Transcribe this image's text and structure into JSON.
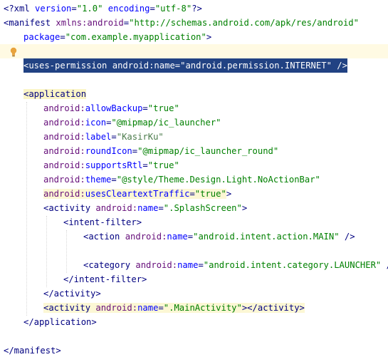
{
  "editor": {
    "file_type": "xml",
    "lines": [
      {
        "indent": 0,
        "segments": [
          {
            "t": "tag",
            "s": "<?xml "
          },
          {
            "t": "attr",
            "s": "version"
          },
          {
            "t": "tag",
            "s": "="
          },
          {
            "t": "val",
            "s": "\"1.0\""
          },
          {
            "t": "tag",
            "s": " "
          },
          {
            "t": "attr",
            "s": "encoding"
          },
          {
            "t": "tag",
            "s": "="
          },
          {
            "t": "val",
            "s": "\"utf-8\""
          },
          {
            "t": "tag",
            "s": "?>"
          }
        ]
      },
      {
        "indent": 0,
        "segments": [
          {
            "t": "tag",
            "s": "<manifest "
          },
          {
            "t": "attr-ns",
            "s": "xmlns:android"
          },
          {
            "t": "tag",
            "s": "="
          },
          {
            "t": "val",
            "s": "\"http://schemas.android.com/apk/res/android\""
          }
        ]
      },
      {
        "indent": 4,
        "segments": [
          {
            "t": "attr",
            "s": "package"
          },
          {
            "t": "tag",
            "s": "="
          },
          {
            "t": "val",
            "s": "\"com.example.myapplication\""
          },
          {
            "t": "tag",
            "s": ">"
          }
        ]
      },
      {
        "indent": 0,
        "segments": [],
        "caret": true,
        "bulb": true
      },
      {
        "indent": 4,
        "selected": true,
        "segments": [
          {
            "t": "sel",
            "s": "<uses-permission android:name=\"android.permission.INTERNET\" />"
          }
        ]
      },
      {
        "indent": 0,
        "segments": []
      },
      {
        "indent": 4,
        "segments": [
          {
            "t": "tag",
            "s": "<",
            "hl": "yellow2"
          },
          {
            "t": "tag",
            "s": "application",
            "hl": "yellow2"
          }
        ]
      },
      {
        "indent": 8,
        "segments": [
          {
            "t": "attr-ns",
            "s": "android:"
          },
          {
            "t": "attr",
            "s": "allowBackup"
          },
          {
            "t": "tag",
            "s": "="
          },
          {
            "t": "val",
            "s": "\"true\""
          }
        ]
      },
      {
        "indent": 8,
        "segments": [
          {
            "t": "attr-ns",
            "s": "android:"
          },
          {
            "t": "attr",
            "s": "icon"
          },
          {
            "t": "tag",
            "s": "="
          },
          {
            "t": "val",
            "s": "\"@mipmap/ic_launcher\""
          }
        ]
      },
      {
        "indent": 8,
        "segments": [
          {
            "t": "attr-ns",
            "s": "android:"
          },
          {
            "t": "attr",
            "s": "label"
          },
          {
            "t": "tag",
            "s": "="
          },
          {
            "t": "val-dim",
            "s": "\"KasirKu\""
          }
        ]
      },
      {
        "indent": 8,
        "segments": [
          {
            "t": "attr-ns",
            "s": "android:"
          },
          {
            "t": "attr",
            "s": "roundIcon"
          },
          {
            "t": "tag",
            "s": "="
          },
          {
            "t": "val",
            "s": "\"@mipmap/ic_launcher_round\""
          }
        ]
      },
      {
        "indent": 8,
        "segments": [
          {
            "t": "attr-ns",
            "s": "android:"
          },
          {
            "t": "attr",
            "s": "supportsRtl"
          },
          {
            "t": "tag",
            "s": "="
          },
          {
            "t": "val",
            "s": "\"true\""
          }
        ]
      },
      {
        "indent": 8,
        "segments": [
          {
            "t": "attr-ns",
            "s": "android:"
          },
          {
            "t": "attr",
            "s": "theme"
          },
          {
            "t": "tag",
            "s": "="
          },
          {
            "t": "val",
            "s": "\"@style/Theme.Design.Light.NoActionBar\""
          }
        ]
      },
      {
        "indent": 8,
        "segments": [
          {
            "t": "attr-ns",
            "s": "android:",
            "hl": "yellow"
          },
          {
            "t": "attr",
            "s": "usesCleartextTraffic",
            "hl": "yellow"
          },
          {
            "t": "tag",
            "s": "=",
            "hl": "yellow"
          },
          {
            "t": "val",
            "s": "\"true\"",
            "hl": "yellow"
          },
          {
            "t": "tag",
            "s": ">"
          }
        ]
      },
      {
        "indent": 8,
        "segments": [
          {
            "t": "tag",
            "s": "<activity "
          },
          {
            "t": "attr-ns",
            "s": "android:"
          },
          {
            "t": "attr",
            "s": "name"
          },
          {
            "t": "tag",
            "s": "="
          },
          {
            "t": "val",
            "s": "\".SplashScreen\""
          },
          {
            "t": "tag",
            "s": ">"
          }
        ]
      },
      {
        "indent": 12,
        "segments": [
          {
            "t": "tag",
            "s": "<intent-filter>"
          }
        ]
      },
      {
        "indent": 16,
        "segments": [
          {
            "t": "tag",
            "s": "<action "
          },
          {
            "t": "attr-ns",
            "s": "android:"
          },
          {
            "t": "attr",
            "s": "name"
          },
          {
            "t": "tag",
            "s": "="
          },
          {
            "t": "val",
            "s": "\"android.intent.action.MAIN\""
          },
          {
            "t": "tag",
            "s": " />"
          }
        ]
      },
      {
        "indent": 0,
        "segments": []
      },
      {
        "indent": 16,
        "segments": [
          {
            "t": "tag",
            "s": "<category "
          },
          {
            "t": "attr-ns",
            "s": "android:"
          },
          {
            "t": "attr",
            "s": "name"
          },
          {
            "t": "tag",
            "s": "="
          },
          {
            "t": "val",
            "s": "\"android.intent.category.LAUNCHER\""
          },
          {
            "t": "tag",
            "s": " />"
          }
        ]
      },
      {
        "indent": 12,
        "segments": [
          {
            "t": "tag",
            "s": "</intent-filter>"
          }
        ]
      },
      {
        "indent": 8,
        "segments": [
          {
            "t": "tag",
            "s": "</activity>"
          }
        ]
      },
      {
        "indent": 8,
        "segments": [
          {
            "t": "tag",
            "s": "<activity ",
            "hl": "yellow"
          },
          {
            "t": "attr-ns",
            "s": "android:",
            "hl": "yellow"
          },
          {
            "t": "attr",
            "s": "name",
            "hl": "yellow"
          },
          {
            "t": "tag",
            "s": "=",
            "hl": "yellow"
          },
          {
            "t": "val",
            "s": "\".MainActivity\"",
            "hl": "yellow"
          },
          {
            "t": "tag",
            "s": "></activity>",
            "hl": "yellow"
          }
        ]
      },
      {
        "indent": 4,
        "segments": [
          {
            "t": "tag",
            "s": "</application>"
          }
        ]
      },
      {
        "indent": 0,
        "segments": []
      },
      {
        "indent": 0,
        "segments": [
          {
            "t": "tag",
            "s": "</manifest>"
          }
        ]
      }
    ]
  },
  "gutter": {
    "icon": "lightbulb-icon",
    "bulb_color": "#e8a33d"
  }
}
